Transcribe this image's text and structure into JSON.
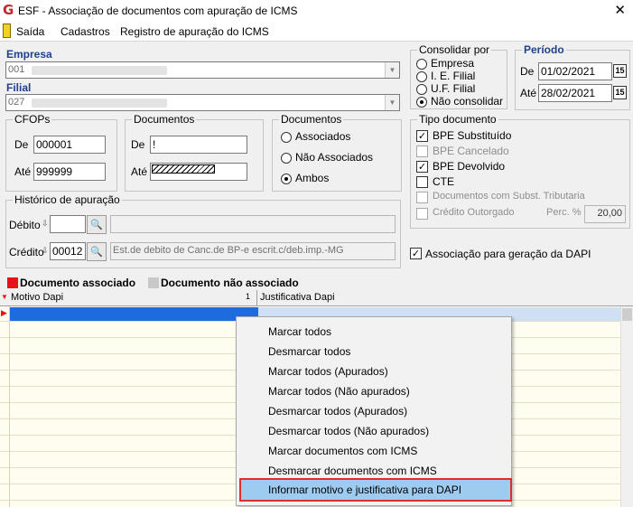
{
  "window": {
    "title": "ESF - Associação de documentos com apuração de ICMS",
    "close_glyph": "✕"
  },
  "menu": [
    "Saída",
    "Cadastros",
    "Registro de apuração do ICMS"
  ],
  "empresa": {
    "label": "Empresa",
    "value": "001"
  },
  "filial": {
    "label": "Filial",
    "value": "027"
  },
  "consolidar": {
    "title": "Consolidar por",
    "options": [
      "Empresa",
      "I. E. Filial",
      "U.F. Filial",
      "Não consolidar"
    ],
    "selected": 3
  },
  "periodo": {
    "title": "Período",
    "de_label": "De",
    "de": "01/02/2021",
    "ate_label": "Até",
    "ate": "28/02/2021",
    "cal_glyph": "15"
  },
  "cfops": {
    "title": "CFOPs",
    "de_label": "De",
    "de": "000001",
    "ate_label": "Até",
    "ate": "999999"
  },
  "documentos_range": {
    "title": "Documentos",
    "de_label": "De",
    "de": "!",
    "ate_label": "Até"
  },
  "documentos_filter": {
    "title": "Documentos",
    "options": [
      "Associados",
      "Não Associados",
      "Ambos"
    ],
    "selected": 2
  },
  "tipo_documento": {
    "title": "Tipo documento",
    "items": [
      {
        "label": "BPE Substituído",
        "checked": true,
        "enabled": true
      },
      {
        "label": "BPE Cancelado",
        "checked": false,
        "enabled": false
      },
      {
        "label": "BPE Devolvido",
        "checked": true,
        "enabled": true
      },
      {
        "label": "CTE",
        "checked": false,
        "enabled": true
      },
      {
        "label": "Documentos com Subst. Tributaria",
        "checked": false,
        "enabled": false
      },
      {
        "label": "Crédito Outorgado",
        "checked": false,
        "enabled": false
      }
    ],
    "perc_label": "Perc. %",
    "perc_value": "20,00"
  },
  "historico": {
    "title": "Histórico de apuração",
    "debito_label": "Débito",
    "credito_label": "Crédito",
    "credito_code": "00012",
    "credito_desc": "Est.de debito de Canc.de BP-e escrit.c/deb.imp.-MG"
  },
  "dapi": {
    "label": "Associação para geração da DAPI",
    "checked": true
  },
  "legend": {
    "associado": {
      "label": "Documento associado",
      "color": "#e8101a"
    },
    "nao_associado": {
      "label": "Documento não associado",
      "color": "#c8c8c8"
    }
  },
  "grid": {
    "columns": [
      "Motivo Dapi",
      "Justificativa Dapi"
    ],
    "sort_badge": "1"
  },
  "context_menu": {
    "items": [
      "Marcar todos",
      "Desmarcar todos",
      "Marcar todos (Apurados)",
      "Marcar todos (Não apurados)",
      "Desmarcar todos (Apurados)",
      "Desmarcar todos (Não apurados)",
      "Marcar documentos com ICMS",
      "Desmarcar documentos com ICMS",
      "Informar motivo e justificativa para DAPI"
    ]
  }
}
